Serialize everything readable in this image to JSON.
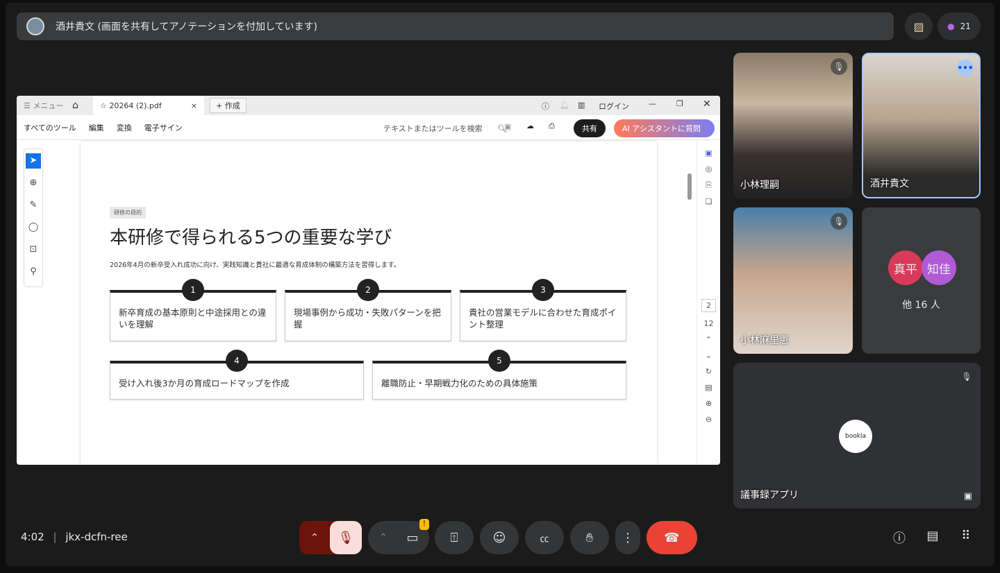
{
  "banner": {
    "text": "酒井貴文 (画面を共有してアノテーションを付加しています)"
  },
  "participants_count": "21",
  "pdf": {
    "menu": "メニュー",
    "tab_title": "20264 (2).pdf",
    "new_button": "作成",
    "login": "ログイン",
    "toolbar": [
      "すべてのツール",
      "編集",
      "変換",
      "電子サイン"
    ],
    "search_placeholder": "テキストまたはツールを検索",
    "share_button": "共有",
    "ai_button": "AI アシスタントに質問",
    "page_current": "2",
    "page_total": "12",
    "badge": "研修の目的",
    "title": "本研修で得られる5つの重要な学び",
    "subtitle": "2026年4月の新卒受入れ成功に向け、実践知識と貴社に最適な育成体制の構築方法を習得します。",
    "cards": [
      {
        "num": "1",
        "text": "新卒育成の基本原則と中途採用との違いを理解"
      },
      {
        "num": "2",
        "text": "現場事例から成功・失敗パターンを把握"
      },
      {
        "num": "3",
        "text": "貴社の営業モデルに合わせた育成ポイント整理"
      },
      {
        "num": "4",
        "text": "受け入れ後3か月の育成ロードマップを作成"
      },
      {
        "num": "5",
        "text": "離職防止・早期戦力化のための具体施策"
      }
    ]
  },
  "tiles": [
    {
      "name": "小林理嗣"
    },
    {
      "name": "酒井貴文"
    },
    {
      "name": "小林麻里恵"
    },
    {
      "avatars": [
        "真平",
        "知佳"
      ],
      "others": "他 16 人"
    },
    {
      "name": "議事録アプリ",
      "logo": "bookla"
    }
  ],
  "footer": {
    "time": "4:02",
    "separator": "|",
    "meeting_code": "jkx-dcfn-ree"
  },
  "colors": {
    "end_call": "#ea4335",
    "mic_off": "#f9dedc",
    "accent_ai": "#ff7a59"
  }
}
